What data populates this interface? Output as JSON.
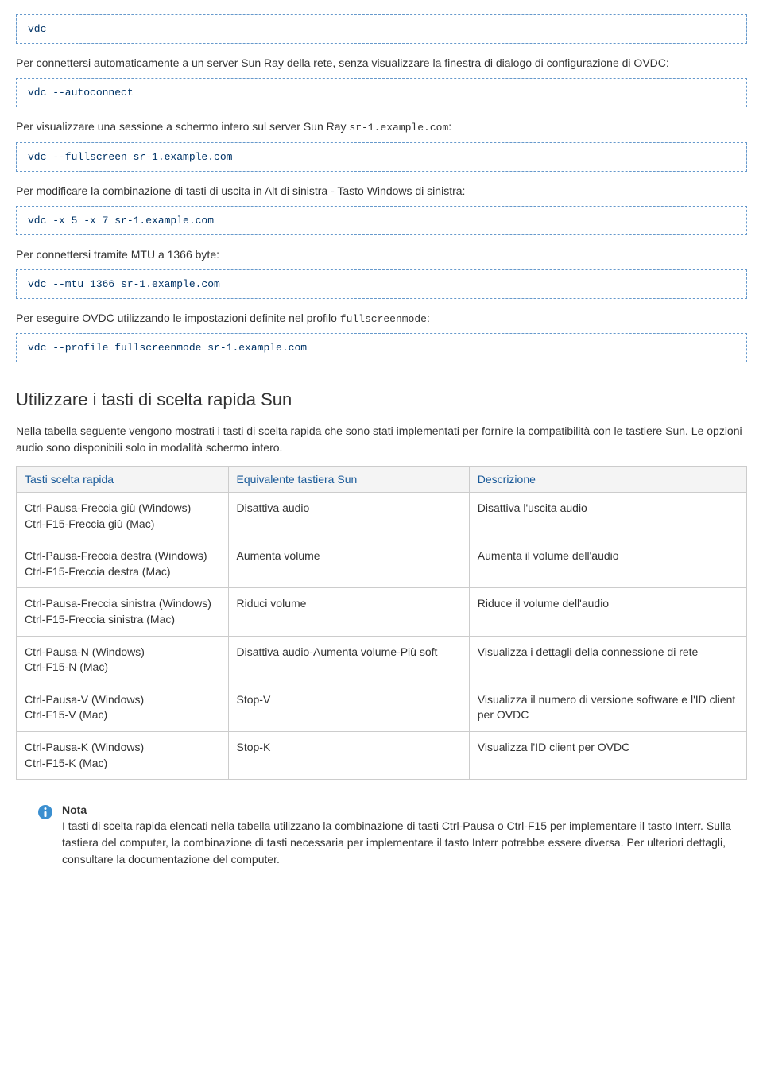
{
  "code1": "vdc",
  "para1_a": "Per connettersi automaticamente a un server Sun Ray della rete, senza visualizzare la finestra di dialogo di configurazione di OVDC:",
  "code2": "vdc --autoconnect",
  "para2_a": "Per visualizzare una sessione a schermo intero sul server Sun Ray ",
  "para2_code": "sr-1.example.com",
  "para2_b": ":",
  "code3": "vdc --fullscreen sr-1.example.com",
  "para3": "Per modificare la combinazione di tasti di uscita in Alt di sinistra - Tasto Windows di sinistra:",
  "code4": "vdc -x 5 -x 7 sr-1.example.com",
  "para4": "Per connettersi tramite MTU a 1366 byte:",
  "code5": "vdc --mtu 1366 sr-1.example.com",
  "para5_a": "Per eseguire OVDC utilizzando le impostazioni definite nel profilo ",
  "para5_code": "fullscreenmode",
  "para5_b": ":",
  "code6": "vdc --profile fullscreenmode sr-1.example.com",
  "section_title": "Utilizzare i tasti di scelta rapida Sun",
  "intro_para": "Nella tabella seguente vengono mostrati i tasti di scelta rapida che sono stati implementati per fornire la compatibilità con le tastiere Sun. Le opzioni audio sono disponibili solo in modalità schermo intero.",
  "table": {
    "headers": [
      "Tasti scelta rapida",
      "Equivalente tastiera Sun",
      "Descrizione"
    ],
    "rows": [
      {
        "c0_l1": "Ctrl-Pausa-Freccia giù (Windows)",
        "c0_l2": "Ctrl-F15-Freccia giù (Mac)",
        "c1": "Disattiva audio",
        "c2": "Disattiva l'uscita audio"
      },
      {
        "c0_l1": "Ctrl-Pausa-Freccia destra (Windows)",
        "c0_l2": "Ctrl-F15-Freccia destra (Mac)",
        "c1": "Aumenta volume",
        "c2": "Aumenta il volume dell'audio"
      },
      {
        "c0_l1": "Ctrl-Pausa-Freccia sinistra (Windows)",
        "c0_l2": "Ctrl-F15-Freccia sinistra (Mac)",
        "c1": "Riduci volume",
        "c2": "Riduce il volume dell'audio"
      },
      {
        "c0_l1": "Ctrl-Pausa-N (Windows)",
        "c0_l2": "Ctrl-F15-N (Mac)",
        "c1": "Disattiva audio-Aumenta volume-Più soft",
        "c2": "Visualizza i dettagli della connessione di rete"
      },
      {
        "c0_l1": "Ctrl-Pausa-V (Windows)",
        "c0_l2": "Ctrl-F15-V (Mac)",
        "c1": "Stop-V",
        "c2": "Visualizza il numero di versione software e l'ID client per OVDC"
      },
      {
        "c0_l1": "Ctrl-Pausa-K (Windows)",
        "c0_l2": "Ctrl-F15-K (Mac)",
        "c1": "Stop-K",
        "c2": "Visualizza l'ID client per OVDC"
      }
    ]
  },
  "note": {
    "title": "Nota",
    "body": "I tasti di scelta rapida elencati nella tabella utilizzano la combinazione di tasti Ctrl-Pausa o Ctrl-F15 per implementare il tasto Interr. Sulla tastiera del computer, la combinazione di tasti necessaria per implementare il tasto Interr potrebbe essere diversa. Per ulteriori dettagli, consultare la documentazione del computer."
  }
}
